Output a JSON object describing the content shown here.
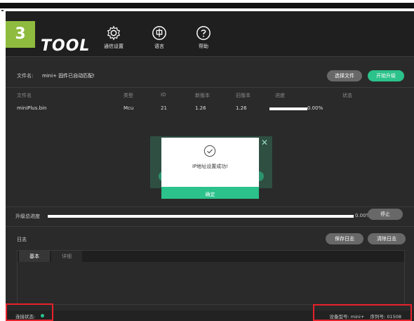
{
  "step_badge": "3",
  "app": {
    "logo": "TOOL",
    "nav": [
      {
        "label": "通信设置",
        "icon": "gear-icon"
      },
      {
        "label": "语言",
        "icon": "language-icon"
      },
      {
        "label": "帮助",
        "icon": "help-icon"
      }
    ]
  },
  "file_bar": {
    "label": "文件名:",
    "value": "mini+ 固件已自动匹配!",
    "select_button": "选择文件",
    "start_button": "开始升级"
  },
  "table": {
    "headers": [
      "文件名",
      "类型",
      "ID",
      "新版本",
      "旧版本",
      "进度",
      "状态"
    ],
    "rows": [
      {
        "file": "miniPlus.bin",
        "type": "Mcu",
        "id": "21",
        "new_version": "1.26",
        "old_version": "1.26",
        "progress": "0.00%",
        "progress_fraction": 1.0
      }
    ]
  },
  "dialog": {
    "message": "IP地址设置成功!",
    "ok_button": "确定"
  },
  "total_progress": {
    "label": "升级总进度",
    "percent": "0.00%",
    "stop_button": "停止",
    "fill_fraction": 1.0
  },
  "log": {
    "title": "日志",
    "save_button": "保存日志",
    "clear_button": "清除日志",
    "tabs": [
      "基本",
      "详细"
    ]
  },
  "status_bar": {
    "connection_label": "连接状态:",
    "device_model_label": "设备型号:",
    "device_model": "mini+",
    "serial_label": "序列号:",
    "serial": "01508"
  },
  "colors": {
    "accent_green": "#2bc28b",
    "badge_green": "#8fbb3f",
    "highlight_red": "#e8212b",
    "background": "#2a2a2a"
  }
}
